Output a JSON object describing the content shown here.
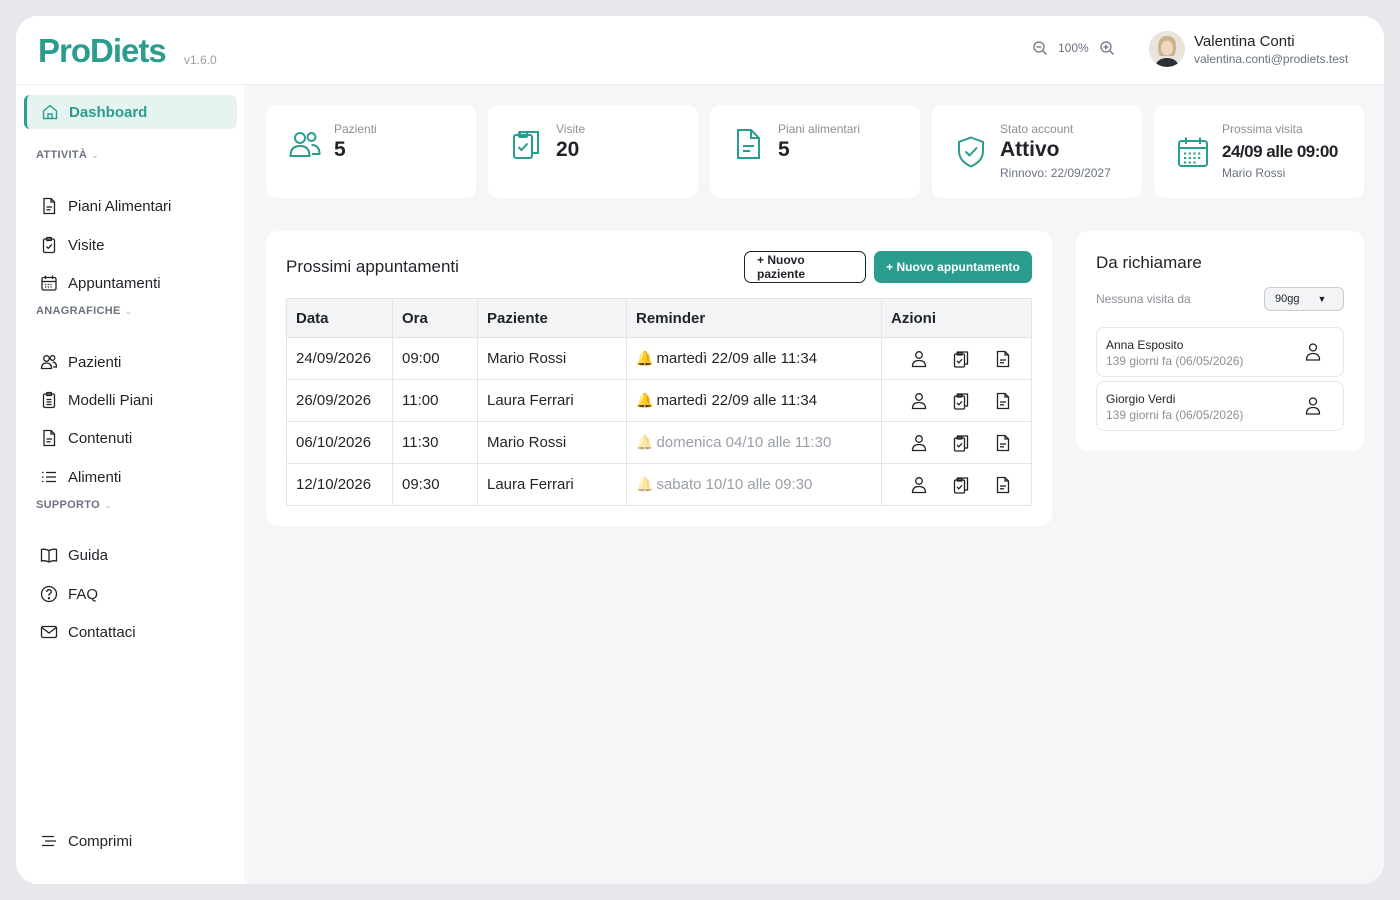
{
  "app": {
    "name": "ProDiets",
    "version": "v1.6.0"
  },
  "header": {
    "zoom_level": "100%",
    "user": {
      "name": "Valentina Conti",
      "email": "valentina.conti@prodiets.test"
    }
  },
  "sidebar": {
    "active": {
      "label": "Dashboard",
      "icon": "home-icon"
    },
    "sections": [
      {
        "title": "ATTIVITÀ",
        "items": [
          {
            "label": "Piani Alimentari",
            "icon": "document-icon"
          },
          {
            "label": "Visite",
            "icon": "clipboard-check-icon"
          },
          {
            "label": "Appuntamenti",
            "icon": "calendar-icon"
          }
        ]
      },
      {
        "title": "ANAGRAFICHE",
        "items": [
          {
            "label": "Pazienti",
            "icon": "users-icon"
          },
          {
            "label": "Modelli Piani",
            "icon": "clipboard-list-icon"
          },
          {
            "label": "Contenuti",
            "icon": "document-icon"
          },
          {
            "label": "Alimenti",
            "icon": "list-icon"
          }
        ]
      },
      {
        "title": "SUPPORTO",
        "items": [
          {
            "label": "Guida",
            "icon": "book-icon"
          },
          {
            "label": "FAQ",
            "icon": "question-icon"
          },
          {
            "label": "Contattaci",
            "icon": "mail-icon"
          }
        ]
      }
    ],
    "collapse_label": "Comprimi"
  },
  "stats": [
    {
      "label": "Pazienti",
      "value": "5",
      "icon": "users-icon"
    },
    {
      "label": "Visite",
      "value": "20",
      "icon": "clipboard-check-icon"
    },
    {
      "label": "Piani alimentari",
      "value": "5",
      "icon": "document-icon"
    },
    {
      "label": "Stato account",
      "value": "Attivo",
      "sub": "Rinnovo: 22/09/2027",
      "icon": "shield-check-icon"
    },
    {
      "label": "Prossima visita",
      "value": "24/09 alle 09:00",
      "sub": "Mario Rossi",
      "icon": "calendar-icon"
    }
  ],
  "appointments": {
    "title": "Prossimi appuntamenti",
    "new_patient_label": "+ Nuovo paziente",
    "new_appointment_label": "+ Nuovo appuntamento",
    "columns": [
      "Data",
      "Ora",
      "Paziente",
      "Reminder",
      "Azioni"
    ],
    "rows": [
      {
        "date": "24/09/2026",
        "time": "09:00",
        "patient": "Mario Rossi",
        "reminder": "martedì 22/09 alle 11:34",
        "reminder_sent": true
      },
      {
        "date": "26/09/2026",
        "time": "11:00",
        "patient": "Laura Ferrari",
        "reminder": "martedì 22/09 alle 11:34",
        "reminder_sent": true
      },
      {
        "date": "06/10/2026",
        "time": "11:30",
        "patient": "Mario Rossi",
        "reminder": "domenica 04/10 alle 11:30",
        "reminder_sent": false
      },
      {
        "date": "12/10/2026",
        "time": "09:30",
        "patient": "Laura Ferrari",
        "reminder": "sabato 10/10 alle 09:30",
        "reminder_sent": false
      }
    ]
  },
  "recall": {
    "title": "Da richiamare",
    "filter_label": "Nessuna visita da",
    "filter_value": "90gg",
    "items": [
      {
        "name": "Anna Esposito",
        "days": "139 giorni fa (06/05/2026)"
      },
      {
        "name": "Giorgio Verdi",
        "days": "139 giorni fa (06/05/2026)"
      }
    ]
  },
  "colors": {
    "accent": "#2a9d8f",
    "accent_light": "#e6f4f1"
  }
}
